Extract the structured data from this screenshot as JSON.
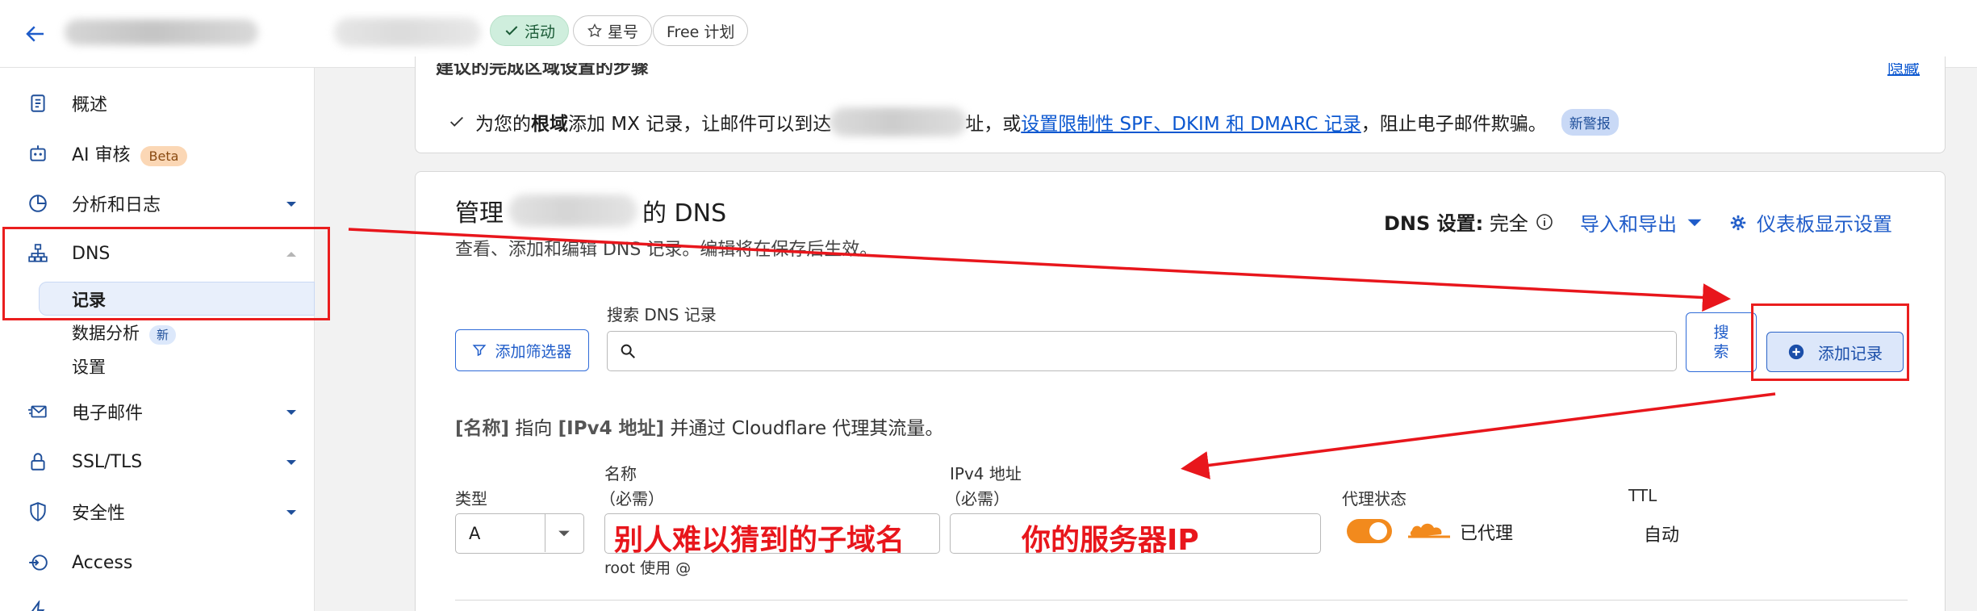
{
  "header": {
    "back_label": "←",
    "status_badge": "活动",
    "star_badge": "星号",
    "plan_badge": "Free 计划"
  },
  "sidebar": {
    "items": [
      {
        "label": "概述"
      },
      {
        "label": "AI 审核",
        "tag": "Beta"
      },
      {
        "label": "分析和日志"
      },
      {
        "label": "DNS"
      },
      {
        "label": "电子邮件"
      },
      {
        "label": "SSL/TLS"
      },
      {
        "label": "安全性"
      },
      {
        "label": "Access"
      }
    ],
    "dns_subitems": [
      {
        "label": "记录"
      },
      {
        "label": "数据分析",
        "tag": "新"
      },
      {
        "label": "设置"
      }
    ]
  },
  "setup_card": {
    "heading": "建议的完成区域设置的步骤",
    "hide_link": "隐藏",
    "task_prefix": "为您的",
    "task_bold": "根域",
    "task_mid": "添加 MX 记录，让邮件可以到达",
    "task_mid2": "址，或",
    "task_link": "设置限制性 SPF、DKIM 和 DMARC 记录",
    "task_suffix": "，阻止电子邮件欺骗。",
    "task_tag": "新警报"
  },
  "dns_card": {
    "title_prefix": "管理",
    "title_suffix": "的 DNS",
    "subtitle": "查看、添加和编辑 DNS 记录。编辑将在保存后生效。",
    "dns_settings_label": "DNS 设置:",
    "dns_settings_value": "完全",
    "import_export": "导入和导出",
    "dashboard_settings": "仪表板显示设置",
    "search_label": "搜索 DNS 记录",
    "search_placeholder": "",
    "filter_button": "添加筛选器",
    "search_button": "搜索",
    "add_record_button": "添加记录",
    "hint_name": "[名称]",
    "hint_mid": " 指向 ",
    "hint_ipv4": "[IPv4 地址]",
    "hint_suffix": " 并通过 Cloudflare 代理其流量。",
    "type_label": "类型",
    "type_value": "A",
    "name_label": "名称",
    "name_required": "（必需）",
    "name_help": "root 使用 @",
    "ipv4_label": "IPv4 地址",
    "ipv4_required": "（必需）",
    "proxy_label": "代理状态",
    "proxy_value": "已代理",
    "ttl_label": "TTL",
    "ttl_value": "自动"
  },
  "annotations": {
    "name_hint": "别人难以猜到的子域名",
    "ip_hint": "你的服务器IP"
  },
  "colors": {
    "accent": "#0b57d0",
    "annotation": "#e8161c",
    "proxy_orange": "#f28a1d"
  }
}
